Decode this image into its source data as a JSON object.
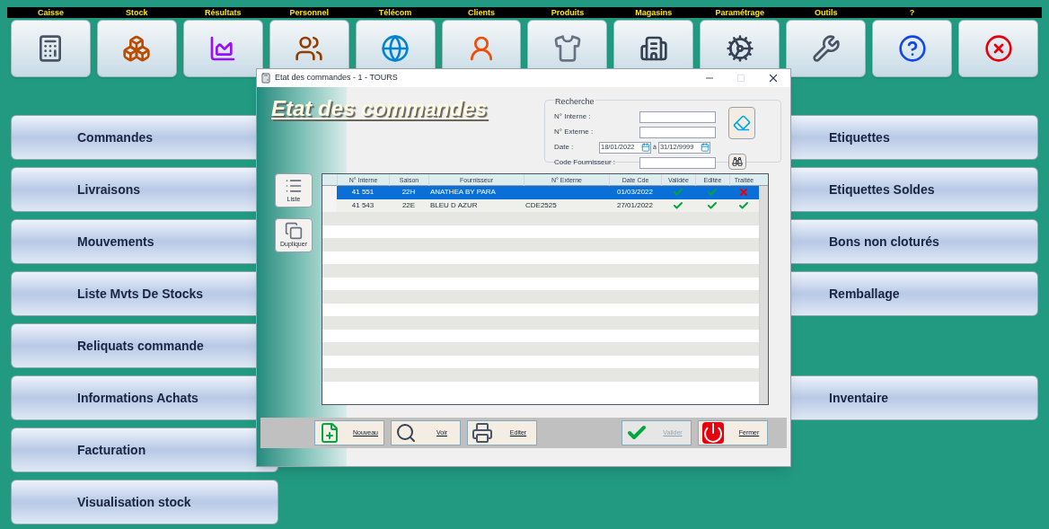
{
  "menu": [
    {
      "label": "Caisse",
      "kind": "register"
    },
    {
      "label": "Stock",
      "kind": "boxes"
    },
    {
      "label": "Résultats",
      "kind": "chart"
    },
    {
      "label": "Personnel",
      "kind": "people"
    },
    {
      "label": "Télécom",
      "kind": "globe"
    },
    {
      "label": "Clients",
      "kind": "client"
    },
    {
      "label": "Produits",
      "kind": "shirt"
    },
    {
      "label": "Magasins",
      "kind": "building"
    },
    {
      "label": "Paramétrage",
      "kind": "gears"
    },
    {
      "label": "Outils",
      "kind": "tools"
    },
    {
      "label": "?",
      "kind": "help"
    },
    {
      "kind": "quit"
    }
  ],
  "left_buttons": [
    "Commandes",
    "Livraisons",
    "Mouvements",
    "Liste Mvts De Stocks",
    "Reliquats commande",
    "Informations Achats",
    "Facturation",
    "Visualisation stock"
  ],
  "right_buttons": [
    {
      "kind": "button",
      "label": "Etiquettes"
    },
    {
      "kind": "button",
      "label": "Etiquettes Soldes"
    },
    {
      "kind": "button",
      "label": "Bons non cloturés"
    },
    {
      "kind": "button",
      "label": "Remballage"
    },
    {
      "kind": "gap"
    },
    {
      "kind": "button",
      "label": "Inventaire"
    }
  ],
  "dialog": {
    "title": "Etat des commandes - 1 - TOURS",
    "heading": "Etat des commandes",
    "search": {
      "legend": "Recherche",
      "internal_label": "N° Interne :",
      "external_label": "N° Externe :",
      "date_label": "Date :",
      "date_from": "18/01/2022",
      "date_sep": "à",
      "date_to": "31/12/9999",
      "supplier_label": "Code Fournisseur :"
    },
    "side_buttons": [
      {
        "label": "Liste",
        "kind": "list"
      },
      {
        "label": "Dupliquer",
        "kind": "copy"
      }
    ],
    "table": {
      "columns": [
        "N° Interne",
        "Saison",
        "Fournisseur",
        "N° Externe",
        "Date Cde",
        "Validée",
        "Editée",
        "Traitée"
      ],
      "rows": [
        {
          "selected": true,
          "internal": "41 551",
          "season": "22H",
          "supplier": "ANATHEA BY PARA",
          "external": "",
          "date": "01/03/2022",
          "validated": true,
          "edited": true,
          "processed": false
        },
        {
          "selected": false,
          "internal": "41 543",
          "season": "22E",
          "supplier": "BLEU D AZUR",
          "external": "CDE2525",
          "date": "27/01/2022",
          "validated": true,
          "edited": true,
          "processed": true
        }
      ]
    },
    "buttons": [
      {
        "label": "Nouveau",
        "kind": "new",
        "disabled": false
      },
      {
        "label": "Voir",
        "kind": "view",
        "disabled": false
      },
      {
        "label": "Editer",
        "kind": "print",
        "disabled": false
      },
      {
        "label": "Valider",
        "kind": "validate",
        "disabled": true
      },
      {
        "label": "Fermer",
        "kind": "close",
        "disabled": false
      }
    ]
  }
}
